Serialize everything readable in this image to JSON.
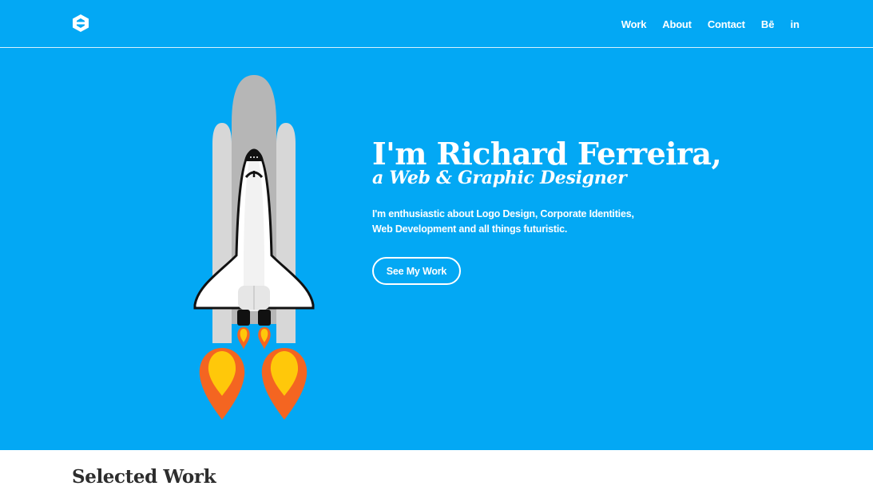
{
  "nav": {
    "logo_icon": "hexagon-logo-icon",
    "links": [
      {
        "label": "Work"
      },
      {
        "label": "About"
      },
      {
        "label": "Contact"
      }
    ],
    "social": [
      {
        "icon": "behance-icon",
        "label": "Bē"
      },
      {
        "icon": "linkedin-icon",
        "label": "in"
      }
    ]
  },
  "hero": {
    "title": "I'm Richard Ferreira,",
    "subtitle": "a Web & Graphic Designer",
    "description_lines": [
      "I'm enthusiastic about Logo Design, Corporate Identities,",
      "Web Development and all things futuristic."
    ],
    "cta_label": "See My Work",
    "illustration_icon": "space-shuttle-icon"
  },
  "selected_work": {
    "title": "Selected Work"
  },
  "colors": {
    "primary": "#03a8f4",
    "text_dark": "#2d2d2d",
    "flame_orange": "#f46521",
    "flame_yellow": "#ffc80a"
  }
}
